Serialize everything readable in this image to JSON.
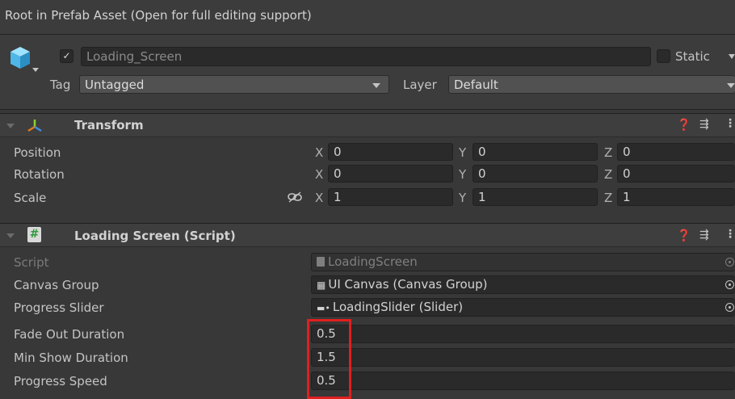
{
  "banner": {
    "text": "Root in Prefab Asset (Open for full editing support)"
  },
  "header": {
    "object_name": "Loading_Screen",
    "active_checked": "✓",
    "static_label": "Static",
    "tag_label": "Tag",
    "tag_value": "Untagged",
    "layer_label": "Layer",
    "layer_value": "Default"
  },
  "transform": {
    "title": "Transform",
    "rows": [
      {
        "label": "Position",
        "x": "0",
        "y": "0",
        "z": "0"
      },
      {
        "label": "Rotation",
        "x": "0",
        "y": "0",
        "z": "0"
      },
      {
        "label": "Scale",
        "x": "1",
        "y": "1",
        "z": "1"
      }
    ],
    "axis": {
      "x": "X",
      "y": "Y",
      "z": "Z"
    }
  },
  "loading_screen": {
    "title": "Loading Screen (Script)",
    "script_label": "Script",
    "script_value": "LoadingScreen",
    "canvas_group_label": "Canvas Group",
    "canvas_group_value": "UI Canvas (Canvas Group)",
    "progress_slider_label": "Progress Slider",
    "progress_slider_value": "LoadingSlider (Slider)",
    "fade_out_label": "Fade Out Duration",
    "fade_out_value": "0.5",
    "min_show_label": "Min Show Duration",
    "min_show_value": "1.5",
    "progress_speed_label": "Progress Speed",
    "progress_speed_value": "0.5"
  },
  "colors": {
    "highlight": "#e01f1f",
    "panel": "#383838"
  },
  "icons": [
    "cube-icon",
    "transform-axes-icon",
    "script-hash-icon",
    "help-icon",
    "presets-icon",
    "more-icon",
    "link-icon",
    "object-picker-icon"
  ]
}
